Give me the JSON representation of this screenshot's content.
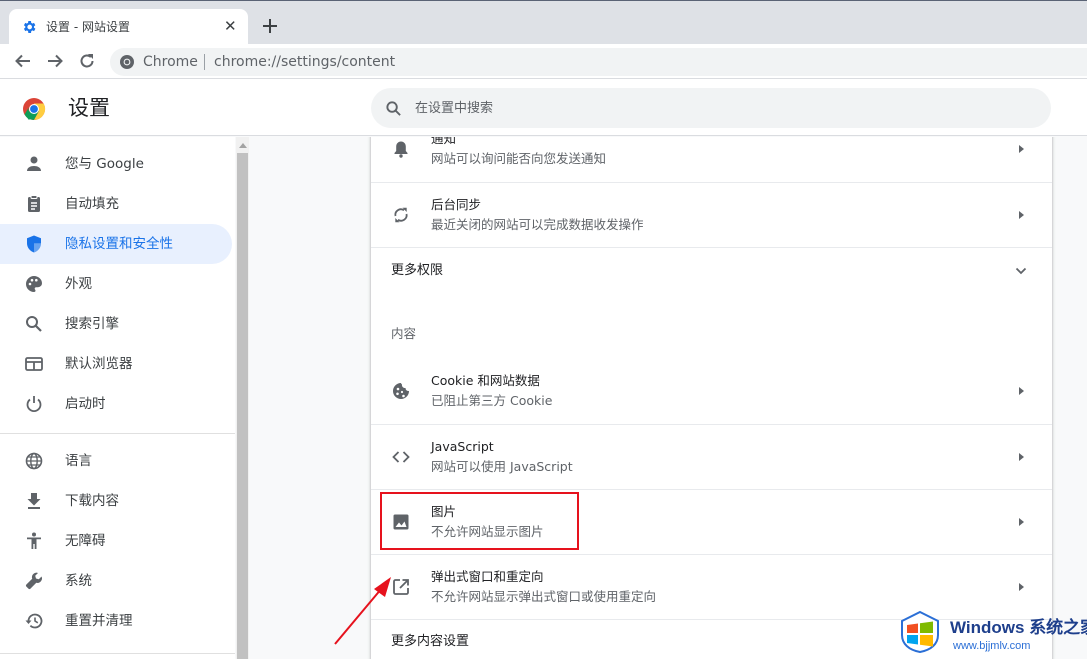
{
  "tab": {
    "title": "设置 - 网站设置",
    "close_glyph": "✕",
    "favicon": "gear-icon"
  },
  "toolbar": {
    "site_label": "Chrome",
    "url": "chrome://settings/content"
  },
  "header": {
    "title": "设置",
    "search_placeholder": "在设置中搜索"
  },
  "sidebar": {
    "items": [
      {
        "label": "您与 Google",
        "icon": "person-icon"
      },
      {
        "label": "自动填充",
        "icon": "clipboard-icon"
      },
      {
        "label": "隐私设置和安全性",
        "icon": "shield-icon",
        "active": true
      },
      {
        "label": "外观",
        "icon": "palette-icon"
      },
      {
        "label": "搜索引擎",
        "icon": "search-icon"
      },
      {
        "label": "默认浏览器",
        "icon": "browser-window-icon"
      },
      {
        "label": "启动时",
        "icon": "power-icon"
      },
      {
        "label": "语言",
        "icon": "globe-icon"
      },
      {
        "label": "下载内容",
        "icon": "download-icon"
      },
      {
        "label": "无障碍",
        "icon": "accessibility-icon"
      },
      {
        "label": "系统",
        "icon": "wrench-icon"
      },
      {
        "label": "重置并清理",
        "icon": "restore-icon"
      }
    ]
  },
  "content": {
    "rows_top": [
      {
        "title": "通知",
        "subtitle": "网站可以询问能否向您发送通知",
        "icon": "bell-icon"
      },
      {
        "title": "后台同步",
        "subtitle": "最近关闭的网站可以完成数据收发操作",
        "icon": "sync-icon"
      }
    ],
    "more_permissions": "更多权限",
    "content_heading": "内容",
    "rows_content": [
      {
        "title": "Cookie 和网站数据",
        "subtitle": "已阻止第三方 Cookie",
        "icon": "cookie-icon"
      },
      {
        "title": "JavaScript",
        "subtitle": "网站可以使用 JavaScript",
        "icon": "code-icon"
      },
      {
        "title": "图片",
        "subtitle": "不允许网站显示图片",
        "icon": "image-icon"
      },
      {
        "title": "弹出式窗口和重定向",
        "subtitle": "不允许网站显示弹出式窗口或使用重定向",
        "icon": "open-in-new-icon"
      }
    ],
    "more_content": "更多内容设置"
  },
  "annotation": {
    "highlight_color": "#e6121d"
  },
  "watermark": {
    "brand": "Windows",
    "brand_cn": "系统之家",
    "url": "www.bjjmlv.com"
  },
  "colors": {
    "accent": "#1a73e8",
    "active_bg": "#e8f0fe"
  }
}
